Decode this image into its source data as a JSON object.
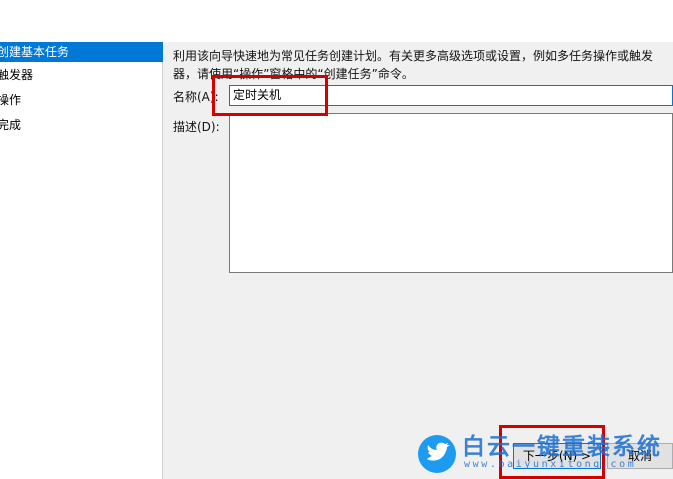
{
  "sidebar": {
    "items": [
      {
        "label": "创建基本任务",
        "active": true
      },
      {
        "label": "触发器"
      },
      {
        "label": "操作"
      },
      {
        "label": "完成"
      }
    ]
  },
  "main": {
    "intro_line1": "利用该向导快速地为常见任务创建计划。有关更多高级选项或设置，例如多任务操作或触发",
    "intro_line2": "器，请使用“操作”窗格中的“创建任务”命令。",
    "name_label": "名称(A):",
    "name_value": "定时关机",
    "description_label": "描述(D):",
    "description_value": ""
  },
  "buttons": {
    "next_label": "下一步(N) >",
    "cancel_label": "取消"
  },
  "watermark": {
    "title": "白云一键重装系统",
    "url": "www.baiyunxitong.com"
  },
  "colors": {
    "selection": "#0078d7",
    "highlight_box": "#d40000",
    "watermark": "#1d6fd0"
  }
}
